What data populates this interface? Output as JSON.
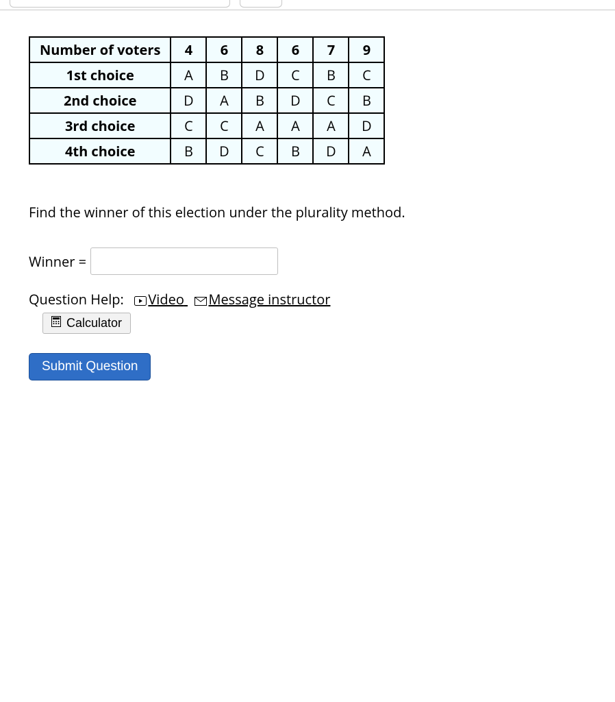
{
  "table": {
    "row_labels": [
      "Number of voters",
      "1st choice",
      "2nd choice",
      "3rd choice",
      "4th choice"
    ],
    "columns": [
      [
        "4",
        "A",
        "D",
        "C",
        "B"
      ],
      [
        "6",
        "B",
        "A",
        "C",
        "D"
      ],
      [
        "8",
        "D",
        "B",
        "A",
        "C"
      ],
      [
        "6",
        "C",
        "D",
        "A",
        "B"
      ],
      [
        "7",
        "B",
        "C",
        "A",
        "D"
      ],
      [
        "9",
        "C",
        "B",
        "D",
        "A"
      ]
    ]
  },
  "question": "Find the winner of this election under the plurality method.",
  "answer": {
    "label": "Winner =",
    "value": ""
  },
  "help": {
    "label": "Question Help:",
    "video": "Video",
    "message": "Message instructor",
    "calculator": "Calculator"
  },
  "submit": "Submit Question",
  "chart_data": {
    "type": "table",
    "row_headers": [
      "Number of voters",
      "1st choice",
      "2nd choice",
      "3rd choice",
      "4th choice"
    ],
    "data": [
      [
        4,
        6,
        8,
        6,
        7,
        9
      ],
      [
        "A",
        "B",
        "D",
        "C",
        "B",
        "C"
      ],
      [
        "D",
        "A",
        "B",
        "D",
        "C",
        "B"
      ],
      [
        "C",
        "C",
        "A",
        "A",
        "A",
        "D"
      ],
      [
        "B",
        "D",
        "C",
        "B",
        "D",
        "A"
      ]
    ]
  }
}
